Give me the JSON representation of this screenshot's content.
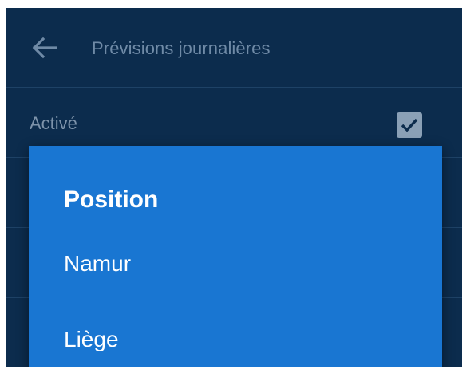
{
  "appbar": {
    "title": "Prévisions journalières",
    "back_icon": "arrow-left-icon"
  },
  "settings": {
    "enabled_label": "Activé",
    "enabled_checked": true
  },
  "dialog": {
    "title": "Position",
    "options": [
      {
        "label": "Namur"
      },
      {
        "label": "Liège"
      }
    ]
  },
  "colors": {
    "background": "#0c2c4d",
    "dialog": "#1976d2",
    "divider": "#1e4266"
  }
}
